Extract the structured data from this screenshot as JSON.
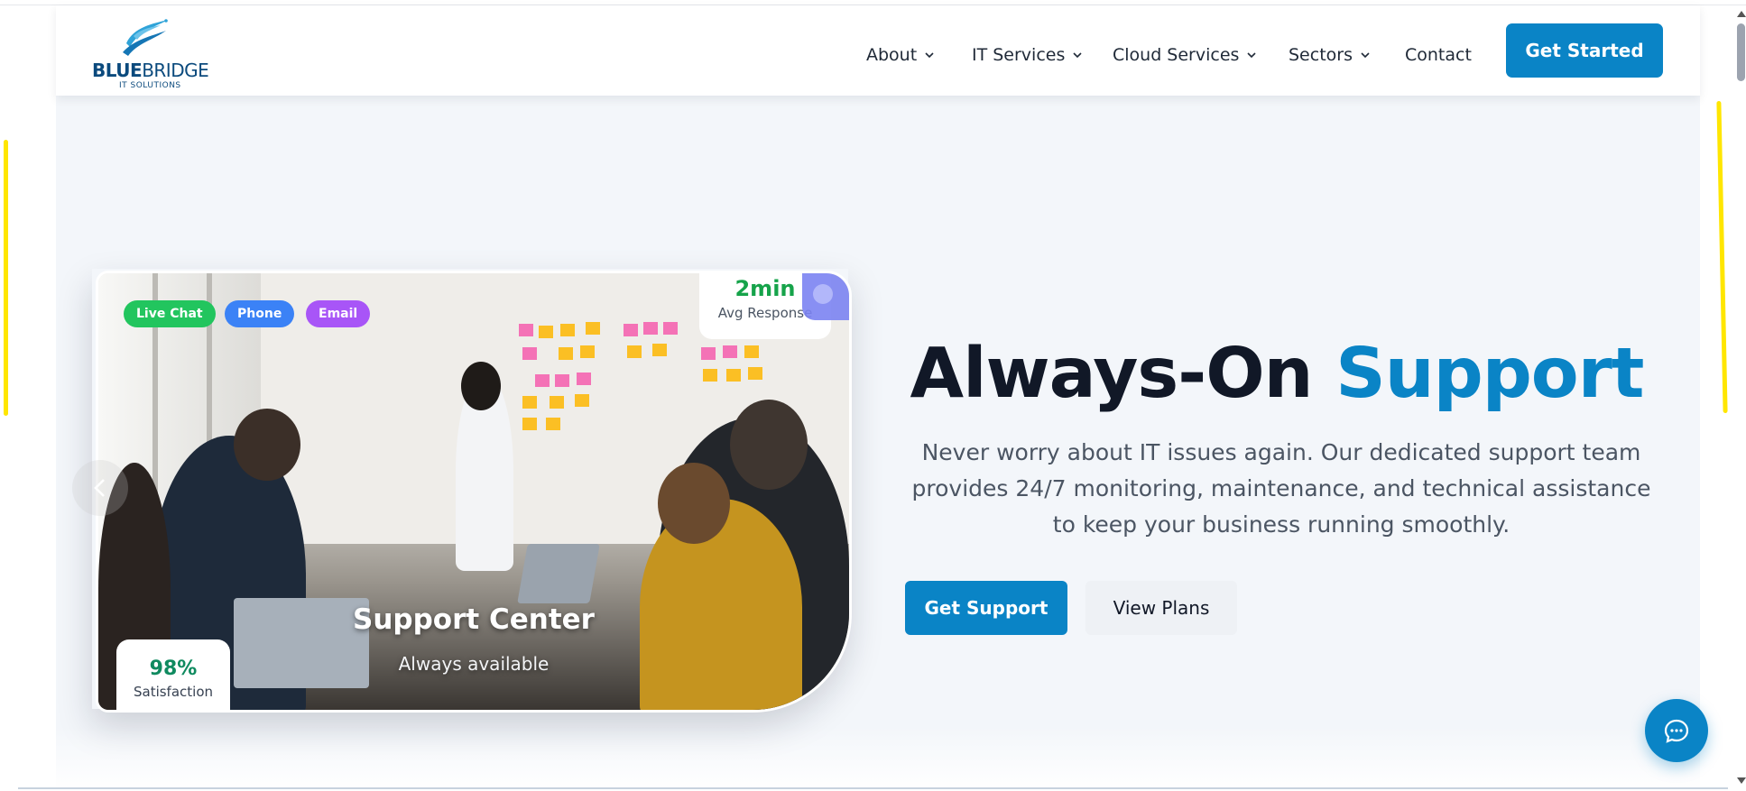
{
  "brand": {
    "name_bold": "BLUE",
    "name_regular": "BRIDGE",
    "subtitle": "IT SOLUTIONS",
    "color": "#0b4a7d"
  },
  "nav": {
    "items": [
      {
        "label": "About",
        "has_dropdown": true
      },
      {
        "label": "IT Services",
        "has_dropdown": true
      },
      {
        "label": "Cloud Services",
        "has_dropdown": true
      },
      {
        "label": "Sectors",
        "has_dropdown": true
      },
      {
        "label": "Contact",
        "has_dropdown": false
      }
    ],
    "cta": "Get Started"
  },
  "hero_card": {
    "badges": [
      {
        "label": "Live Chat",
        "color": "#22c55e"
      },
      {
        "label": "Phone",
        "color": "#3b82f6"
      },
      {
        "label": "Email",
        "color": "#a855f7"
      }
    ],
    "stat_top": {
      "value": "2min",
      "label": "Avg Response"
    },
    "stat_bottom": {
      "value": "98%",
      "label": "Satisfaction"
    },
    "caption_title": "Support Center",
    "caption_subtitle": "Always available",
    "prev_icon": "chevron-left-icon"
  },
  "hero": {
    "title_part1": "Always-On",
    "title_part2": "Support",
    "description": "Never worry about IT issues again. Our dedicated support team provides 24/7 monitoring, maintenance, and technical assistance to keep your business running smoothly.",
    "primary_button": "Get Support",
    "secondary_button": "View Plans"
  },
  "chat_widget": {
    "icon": "chat-bubble-icon"
  },
  "colors": {
    "accent": "#0a84c6",
    "dark_text": "#111827",
    "background": "#f3f6fa"
  }
}
